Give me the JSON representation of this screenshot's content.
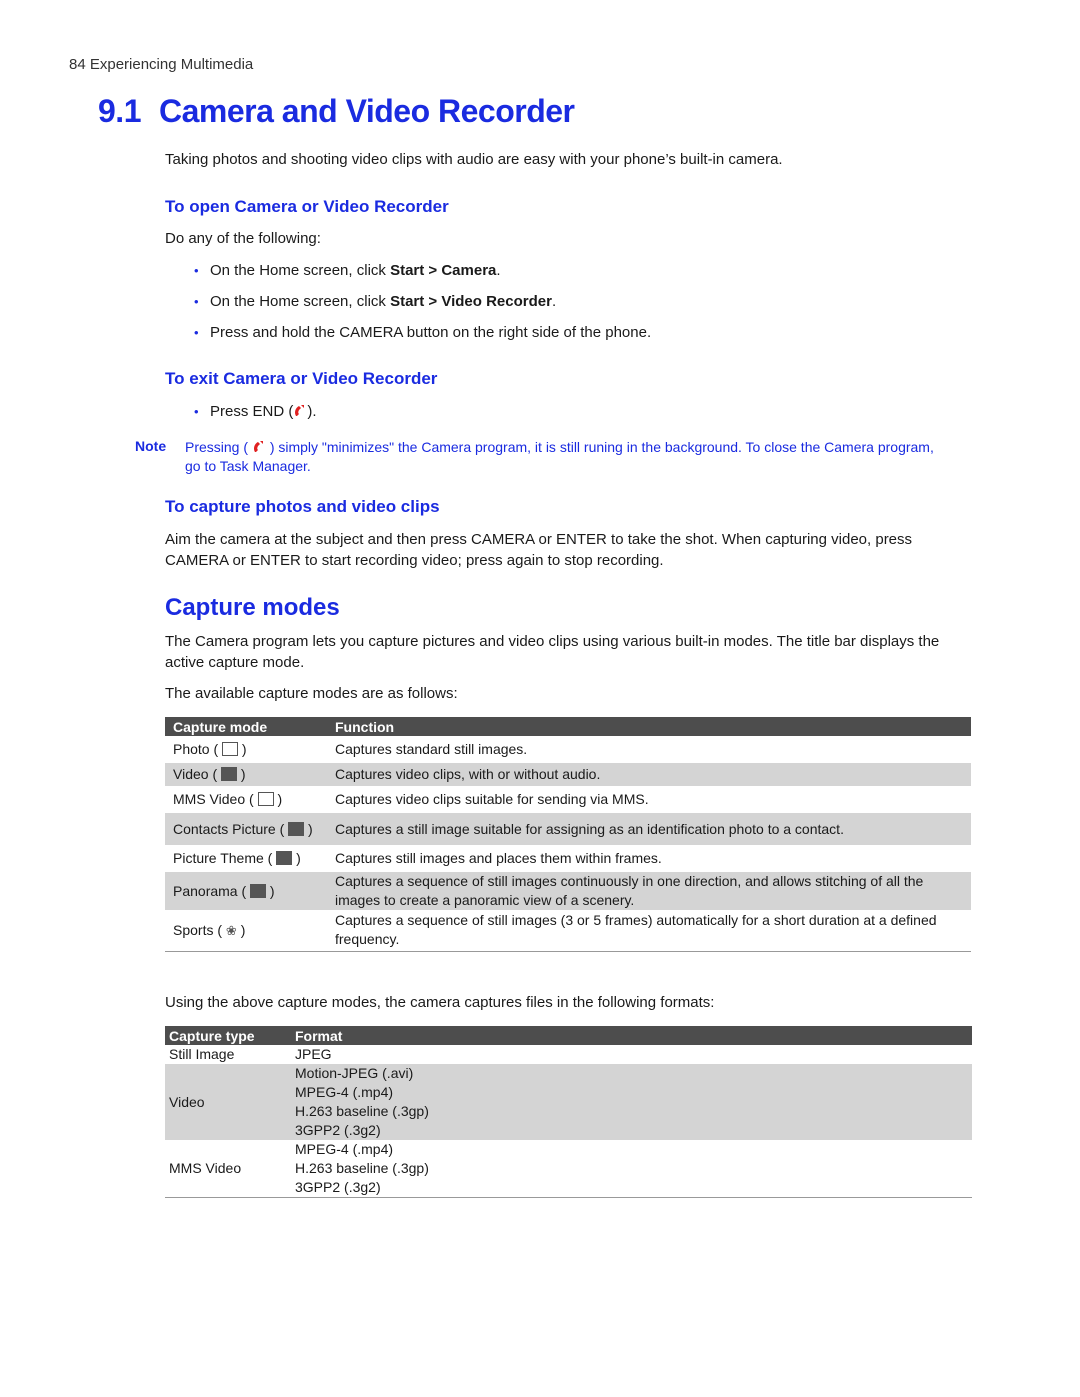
{
  "running_header": "84  Experiencing Multimedia",
  "chapter": {
    "number": "9.1",
    "title": "Camera and Video Recorder",
    "intro": "Taking photos and shooting video clips with audio are easy with your phone’s built-in camera."
  },
  "open_section": {
    "heading": "To open Camera or Video Recorder",
    "lead": "Do any of the following:",
    "items": [
      {
        "prefix": "On the Home screen, click ",
        "bold": "Start > Camera",
        "suffix": "."
      },
      {
        "prefix": "On the Home screen, click ",
        "bold": "Start > Video Recorder",
        "suffix": "."
      },
      {
        "prefix": "Press and hold the CAMERA button on the right side of the phone.",
        "bold": "",
        "suffix": ""
      }
    ]
  },
  "exit_section": {
    "heading": "To exit Camera or Video Recorder",
    "item_prefix": "Press END (",
    "item_suffix": ").",
    "icon": "end-call-icon",
    "icon_color": "#e02020"
  },
  "note": {
    "label": "Note",
    "text_prefix": "Pressing (",
    "text_suffix": ") simply \"minimizes\" the Camera program, it is still runing in the background. To close the Camera program, go to Task Manager."
  },
  "capture_section": {
    "heading": "To capture photos and video clips",
    "text": "Aim the camera at the subject and then press CAMERA or ENTER to take the shot. When capturing video, press CAMERA or ENTER to start recording video; press again to stop recording."
  },
  "modes_section": {
    "heading": "Capture modes",
    "para1": "The Camera program lets you capture pictures and video clips using various built-in modes. The title bar displays the active capture mode.",
    "para2": "The available capture modes are as follows:",
    "table": {
      "headers": [
        "Capture mode",
        "Function"
      ],
      "rows": [
        {
          "mode": "Photo",
          "icon": "photo-mode-icon",
          "function": "Captures standard still images."
        },
        {
          "mode": "Video",
          "icon": "video-mode-icon",
          "function": "Captures video clips, with or without audio."
        },
        {
          "mode": "MMS Video",
          "icon": "mms-video-mode-icon",
          "function": "Captures video clips suitable for sending via MMS."
        },
        {
          "mode": "Contacts Picture",
          "icon": "contacts-picture-mode-icon",
          "function": "Captures a still image suitable for assigning as an identification photo to a contact."
        },
        {
          "mode": "Picture Theme",
          "icon": "picture-theme-mode-icon",
          "function": "Captures still images and places them within frames."
        },
        {
          "mode": "Panorama",
          "icon": "panorama-mode-icon",
          "function": "Captures a sequence of still images continuously in one direction, and allows stitching of all the images to create a panoramic view of a scenery."
        },
        {
          "mode": "Sports",
          "icon": "sports-mode-icon",
          "function": "Captures a sequence of still images (3 or 5 frames) automatically for a short duration at a defined frequency."
        }
      ]
    }
  },
  "formats_section": {
    "intro": "Using the above capture modes, the camera captures files in the following formats:",
    "table": {
      "headers": [
        "Capture type",
        "Format"
      ],
      "rows": [
        {
          "type": "Still Image",
          "formats": [
            "JPEG"
          ]
        },
        {
          "type": "Video",
          "formats": [
            "Motion-JPEG (.avi)",
            "MPEG-4 (.mp4)",
            "H.263 baseline (.3gp)",
            "3GPP2 (.3g2)"
          ]
        },
        {
          "type": "MMS Video",
          "formats": [
            "MPEG-4 (.mp4)",
            "H.263 baseline (.3gp)",
            "3GPP2 (.3g2)"
          ]
        }
      ]
    }
  }
}
